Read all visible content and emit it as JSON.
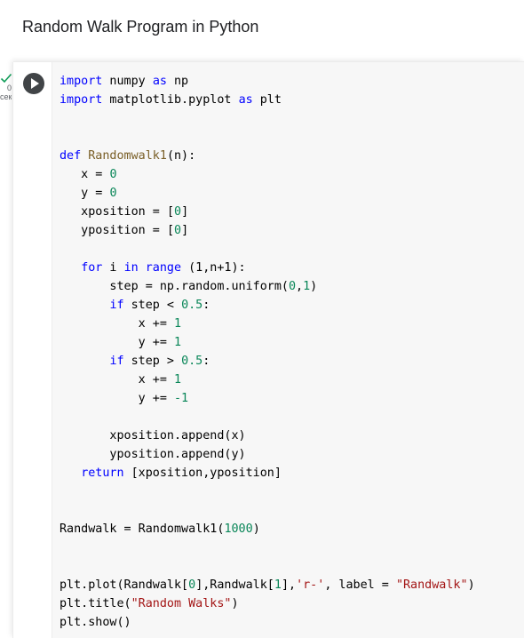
{
  "section": {
    "heading": "Random Walk Program in Python"
  },
  "cell": {
    "execution_count": "0",
    "execution_unit": "сек.",
    "run_label": "Run cell",
    "lines": [
      [
        {
          "t": "kw",
          "v": "import"
        },
        {
          "t": "id",
          "v": " numpy "
        },
        {
          "t": "kw",
          "v": "as"
        },
        {
          "t": "id",
          "v": " np"
        }
      ],
      [
        {
          "t": "kw",
          "v": "import"
        },
        {
          "t": "id",
          "v": " matplotlib.pyplot "
        },
        {
          "t": "kw",
          "v": "as"
        },
        {
          "t": "id",
          "v": " plt"
        }
      ],
      [],
      [],
      [
        {
          "t": "kw",
          "v": "def"
        },
        {
          "t": "id",
          "v": " "
        },
        {
          "t": "fn",
          "v": "Randomwalk1"
        },
        {
          "t": "id",
          "v": "(n):"
        }
      ],
      [
        {
          "t": "id",
          "v": "   x = "
        },
        {
          "t": "num",
          "v": "0"
        }
      ],
      [
        {
          "t": "id",
          "v": "   y = "
        },
        {
          "t": "num",
          "v": "0"
        }
      ],
      [
        {
          "t": "id",
          "v": "   xposition = "
        },
        {
          "t": "br",
          "v": "["
        },
        {
          "t": "num",
          "v": "0"
        },
        {
          "t": "br",
          "v": "]"
        }
      ],
      [
        {
          "t": "id",
          "v": "   yposition = "
        },
        {
          "t": "br",
          "v": "["
        },
        {
          "t": "num",
          "v": "0"
        },
        {
          "t": "br",
          "v": "]"
        }
      ],
      [],
      [
        {
          "t": "id",
          "v": "   "
        },
        {
          "t": "kw",
          "v": "for"
        },
        {
          "t": "id",
          "v": " i "
        },
        {
          "t": "kw",
          "v": "in"
        },
        {
          "t": "id",
          "v": " "
        },
        {
          "t": "kw",
          "v": "range"
        },
        {
          "t": "id",
          "v": " (1,n+1):"
        }
      ],
      [
        {
          "t": "id",
          "v": "       step = np.random.uniform("
        },
        {
          "t": "num",
          "v": "0"
        },
        {
          "t": "id",
          "v": ","
        },
        {
          "t": "num",
          "v": "1"
        },
        {
          "t": "id",
          "v": ")"
        }
      ],
      [
        {
          "t": "id",
          "v": "       "
        },
        {
          "t": "kw",
          "v": "if"
        },
        {
          "t": "id",
          "v": " step < "
        },
        {
          "t": "num",
          "v": "0.5"
        },
        {
          "t": "id",
          "v": ":"
        }
      ],
      [
        {
          "t": "id",
          "v": "           x += "
        },
        {
          "t": "num",
          "v": "1"
        }
      ],
      [
        {
          "t": "id",
          "v": "           y += "
        },
        {
          "t": "num",
          "v": "1"
        }
      ],
      [
        {
          "t": "id",
          "v": "       "
        },
        {
          "t": "kw",
          "v": "if"
        },
        {
          "t": "id",
          "v": " step > "
        },
        {
          "t": "num",
          "v": "0.5"
        },
        {
          "t": "id",
          "v": ":"
        }
      ],
      [
        {
          "t": "id",
          "v": "           x += "
        },
        {
          "t": "num",
          "v": "1"
        }
      ],
      [
        {
          "t": "id",
          "v": "           y += "
        },
        {
          "t": "num",
          "v": "-1"
        }
      ],
      [],
      [
        {
          "t": "id",
          "v": "       xposition.append(x)"
        }
      ],
      [
        {
          "t": "id",
          "v": "       yposition.append(y)"
        }
      ],
      [
        {
          "t": "id",
          "v": "   "
        },
        {
          "t": "kw",
          "v": "return"
        },
        {
          "t": "id",
          "v": " [xposition,yposition]"
        }
      ],
      [],
      [],
      [
        {
          "t": "id",
          "v": "Randwalk = Randomwalk1("
        },
        {
          "t": "num",
          "v": "1000"
        },
        {
          "t": "id",
          "v": ")"
        }
      ],
      [],
      [],
      [
        {
          "t": "id",
          "v": "plt.plot(Randwalk["
        },
        {
          "t": "num",
          "v": "0"
        },
        {
          "t": "id",
          "v": "],Randwalk["
        },
        {
          "t": "num",
          "v": "1"
        },
        {
          "t": "id",
          "v": "],"
        },
        {
          "t": "str",
          "v": "'r-'"
        },
        {
          "t": "id",
          "v": ", label = "
        },
        {
          "t": "str",
          "v": "\"Randwalk\""
        },
        {
          "t": "id",
          "v": ")"
        }
      ],
      [
        {
          "t": "id",
          "v": "plt.title("
        },
        {
          "t": "str",
          "v": "\"Random Walks\""
        },
        {
          "t": "id",
          "v": ")"
        }
      ],
      [
        {
          "t": "id",
          "v": "plt.show()"
        }
      ]
    ]
  },
  "icons": {
    "check": "check-icon",
    "run": "play-icon"
  },
  "colors": {
    "keyword": "#0000ff",
    "number": "#098658",
    "function": "#795e26",
    "string": "#a31515",
    "check": "#0f9d58",
    "run_button": "#414447"
  }
}
